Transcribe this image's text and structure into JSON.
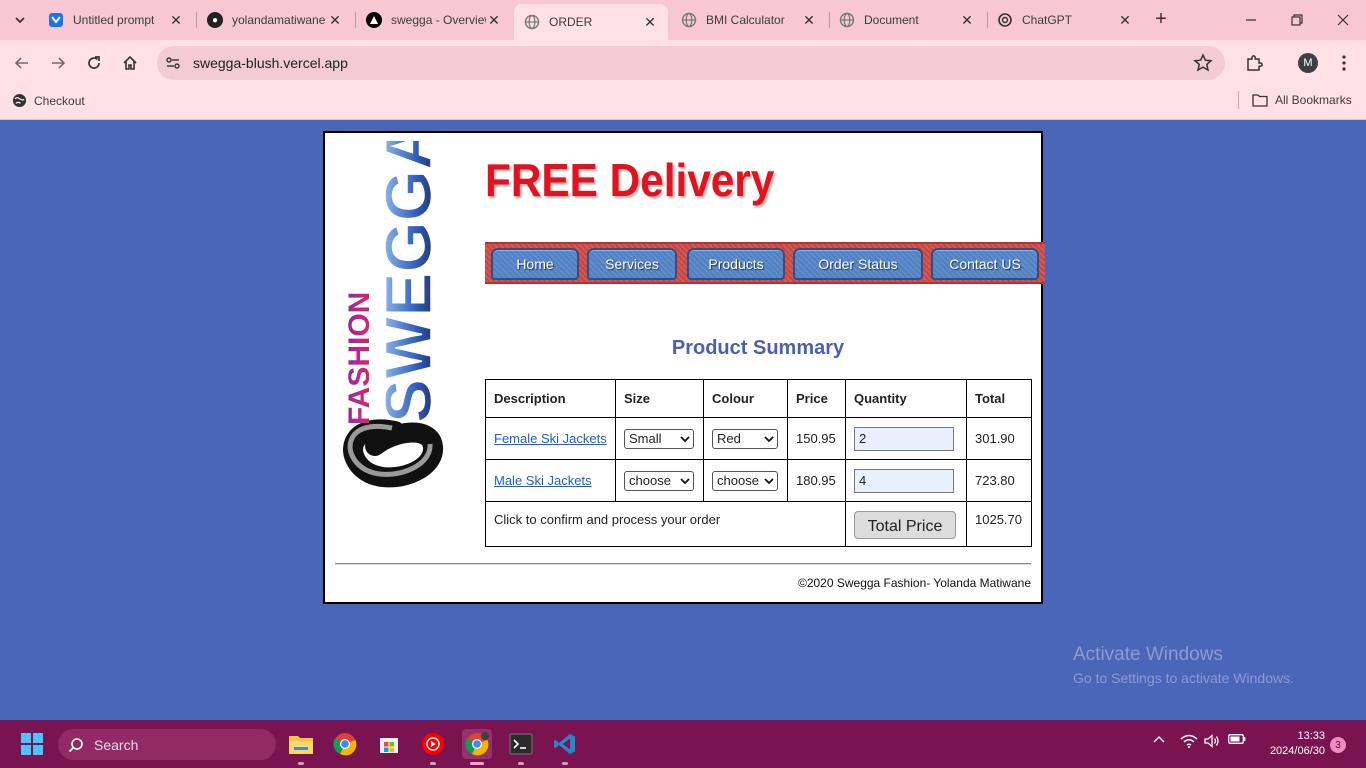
{
  "browser": {
    "tabs": [
      {
        "title": "Untitled prompt",
        "icon": "ai-studio-icon"
      },
      {
        "title": "yolandamatiwane",
        "icon": "github-icon"
      },
      {
        "title": "swegga - Overview",
        "icon": "vercel-icon"
      },
      {
        "title": "ORDER",
        "icon": "globe-icon",
        "active": true
      },
      {
        "title": "BMI Calculator",
        "icon": "globe-icon"
      },
      {
        "title": "Document",
        "icon": "globe-icon"
      },
      {
        "title": "ChatGPT",
        "icon": "chatgpt-icon"
      }
    ],
    "url": "swegga-blush.vercel.app",
    "profile_initial": "M",
    "bookmarks": {
      "item": "Checkout",
      "all": "All Bookmarks"
    }
  },
  "page": {
    "headline": "FREE Delivery",
    "logo_text": {
      "fashion": "FASHION",
      "brand": "SWEGGA"
    },
    "nav": [
      "Home",
      "Services",
      "Products",
      "Order Status",
      "Contact US"
    ],
    "summary_title": "Product Summary",
    "table": {
      "headers": [
        "Description",
        "Size",
        "Colour",
        "Price",
        "Quantity",
        "Total"
      ],
      "rows": [
        {
          "description": "Female Ski Jackets",
          "size": "Small",
          "colour": "Red",
          "price": "150.95",
          "quantity": "2",
          "total": "301.90"
        },
        {
          "description": "Male Ski Jackets",
          "size": "choose",
          "colour": "choose",
          "price": "180.95",
          "quantity": "4",
          "total": "723.80"
        }
      ],
      "confirm_text": "Click to confirm and process your order",
      "total_button": "Total Price",
      "grand_total": "1025.70"
    },
    "footer": "©2020 Swegga Fashion- Yolanda Matiwane"
  },
  "watermark": {
    "line1": "Activate Windows",
    "line2": "Go to Settings to activate Windows."
  },
  "taskbar": {
    "search_label": "Search",
    "time": "13:33",
    "date": "2024/06/30",
    "notifications": "3"
  },
  "colors": {
    "accent_red": "#e2121e",
    "nav_blue": "#4f80c4",
    "page_bg": "#4a66b8",
    "title_blue": "#4a5fb0"
  }
}
